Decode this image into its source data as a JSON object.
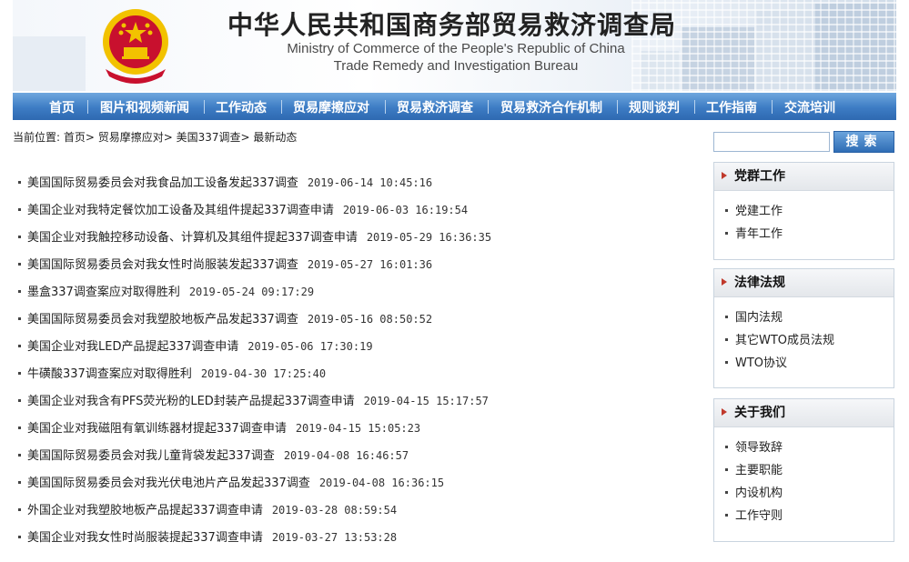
{
  "header": {
    "title_cn": "中华人民共和国商务部贸易救济调查局",
    "title_en_line1": "Ministry of Commerce of the People's Republic of China",
    "title_en_line2": "Trade Remedy and Investigation Bureau",
    "emblem_icon": "national-emblem-icon"
  },
  "nav": {
    "items": [
      "首页",
      "图片和视频新闻",
      "工作动态",
      "贸易摩擦应对",
      "贸易救济调查",
      "贸易救济合作机制",
      "规则谈判",
      "工作指南",
      "交流培训"
    ]
  },
  "breadcrumb": {
    "prefix": "当前位置:",
    "path": "首页> 贸易摩擦应对> 美国337调查> 最新动态"
  },
  "news": [
    {
      "title": "美国国际贸易委员会对我食品加工设备发起337调查",
      "date": "2019-06-14 10:45:16"
    },
    {
      "title": "美国企业对我特定餐饮加工设备及其组件提起337调查申请",
      "date": "2019-06-03 16:19:54"
    },
    {
      "title": "美国企业对我触控移动设备、计算机及其组件提起337调查申请",
      "date": "2019-05-29 16:36:35"
    },
    {
      "title": "美国国际贸易委员会对我女性时尚服装发起337调查",
      "date": "2019-05-27 16:01:36"
    },
    {
      "title": "墨盒337调查案应对取得胜利",
      "date": "2019-05-24 09:17:29"
    },
    {
      "title": "美国国际贸易委员会对我塑胶地板产品发起337调查",
      "date": "2019-05-16 08:50:52"
    },
    {
      "title": "美国企业对我LED产品提起337调查申请",
      "date": "2019-05-06 17:30:19"
    },
    {
      "title": "牛磺酸337调查案应对取得胜利",
      "date": "2019-04-30 17:25:40"
    },
    {
      "title": "美国企业对我含有PFS荧光粉的LED封装产品提起337调查申请",
      "date": "2019-04-15 15:17:57"
    },
    {
      "title": "美国企业对我磁阻有氧训练器材提起337调查申请",
      "date": "2019-04-15 15:05:23"
    },
    {
      "title": "美国国际贸易委员会对我儿童背袋发起337调查",
      "date": "2019-04-08 16:46:57"
    },
    {
      "title": "美国国际贸易委员会对我光伏电池片产品发起337调查",
      "date": "2019-04-08 16:36:15"
    },
    {
      "title": "外国企业对我塑胶地板产品提起337调查申请",
      "date": "2019-03-28 08:59:54"
    },
    {
      "title": "美国企业对我女性时尚服装提起337调查申请",
      "date": "2019-03-27 13:53:28"
    }
  ],
  "search": {
    "placeholder": "",
    "button_label": "搜索"
  },
  "sidebar": {
    "boxes": [
      {
        "title": "党群工作",
        "links": [
          "党建工作",
          "青年工作"
        ]
      },
      {
        "title": "法律法规",
        "links": [
          "国内法规",
          "其它WTO成员法规",
          "WTO协议"
        ]
      },
      {
        "title": "关于我们",
        "links": [
          "领导致辞",
          "主要职能",
          "内设机构",
          "工作守则"
        ]
      }
    ]
  },
  "colors": {
    "nav_blue": "#3d7cc4",
    "emblem_red": "#c8102e",
    "emblem_gold": "#f2c200"
  }
}
